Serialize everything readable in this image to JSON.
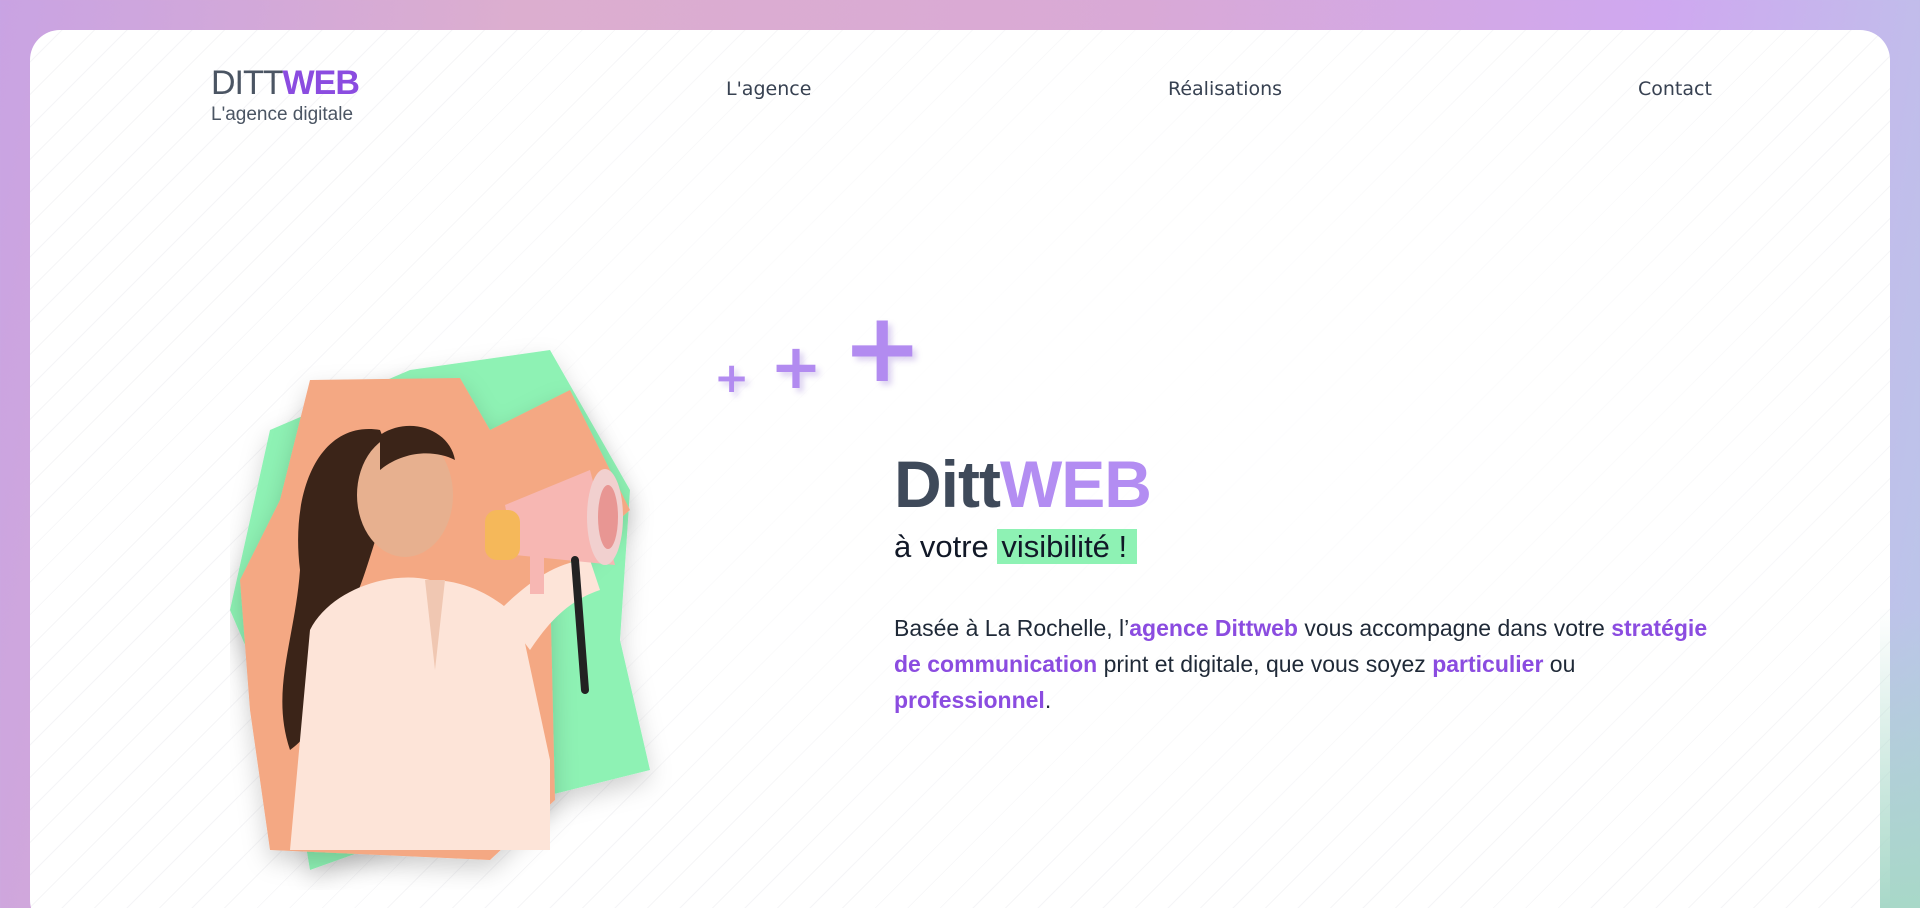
{
  "header": {
    "logo_part1": "DITT",
    "logo_part2": "WEB",
    "logo_tagline": "L'agence digitale",
    "nav": [
      "L'agence",
      "Réalisations",
      "Contact"
    ]
  },
  "hero": {
    "title_part1": "Ditt",
    "title_part2": "WEB",
    "subtitle_prefix": "à votre ",
    "subtitle_highlight": "visibilité !",
    "text": {
      "t1": "Basée à La Rochelle, l’",
      "b1": "agence Dittweb",
      "t2": " vous accompagne dans votre ",
      "b2": "stratégie de communication",
      "t3": " print et digitale, que vous soyez ",
      "b3": "particulier",
      "t4": " ou ",
      "b4": "professionnel",
      "t5": "."
    },
    "image": "woman-with-megaphone",
    "decoration": [
      "plus-icon",
      "plus-icon",
      "plus-icon"
    ]
  },
  "colors": {
    "accent": "#8b4ce0",
    "accent_light": "#b38df2",
    "highlight_green": "#8ef2b4",
    "dark_text": "#3f4a5a"
  }
}
